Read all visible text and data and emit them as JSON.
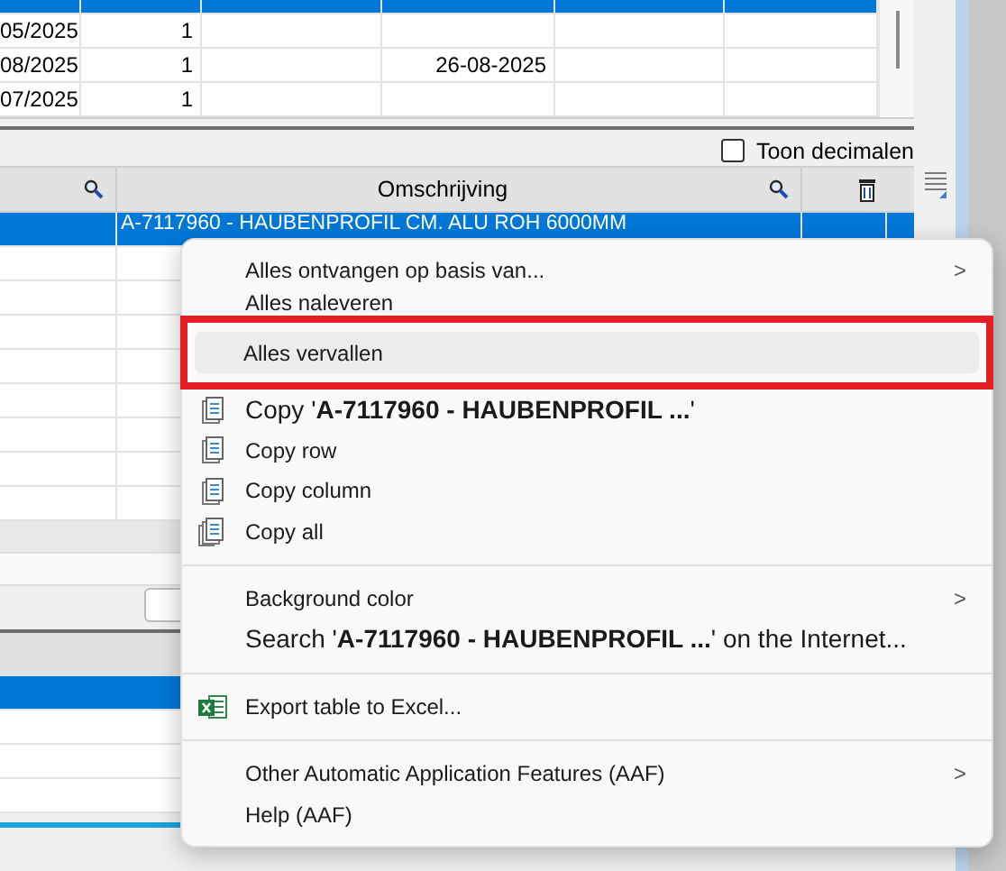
{
  "top_grid": {
    "rows": [
      {
        "selected": true
      },
      {
        "selected": false,
        "column_1": "05/2025",
        "column_2": "1"
      },
      {
        "selected": false,
        "column_1": "08/2025",
        "column_2": "1",
        "column_4": "26-08-2025"
      },
      {
        "selected": false,
        "column_1": "07/2025",
        "column_2": "1"
      }
    ]
  },
  "toolbar": {
    "checkbox": {
      "label": "Toon decimalen",
      "checked": false
    }
  },
  "lower_grid": {
    "heading": "Omschrijving",
    "rows": [
      {
        "selected": true,
        "description": "A-7117960 - HAUBENPROFIL CM. ALU ROH 6000MM"
      },
      {
        "selected": false
      },
      {
        "selected": false
      },
      {
        "selected": false
      },
      {
        "selected": false
      },
      {
        "selected": false
      },
      {
        "selected": false
      },
      {
        "selected": false
      },
      {
        "selected": false
      }
    ]
  },
  "bottom_grid": {
    "rows": [
      {
        "selected": true
      },
      {
        "selected": false
      },
      {
        "selected": false
      },
      {
        "selected": false
      }
    ]
  },
  "context_menu": {
    "items": [
      {
        "kind": "plain",
        "label": "Alles ontvangen op basis van...",
        "arrow": ">",
        "highlighted": false
      },
      {
        "kind": "plain",
        "label": "Alles naleveren",
        "highlighted": false
      },
      {
        "kind": "plain",
        "label": "Alles vervallen",
        "highlighted": true
      },
      {
        "kind": "copy-value",
        "label": "Copy '**A-7117960 - HAUBENPROFIL ...**'",
        "highlighted": false
      },
      {
        "kind": "copy",
        "label": "Copy row",
        "highlighted": false
      },
      {
        "kind": "copy",
        "label": "Copy column",
        "highlighted": false
      },
      {
        "kind": "copy-all",
        "label": "Copy all",
        "highlighted": false
      },
      {
        "kind": "separator"
      },
      {
        "kind": "plain",
        "label": "Background color",
        "arrow": ">",
        "highlighted": false
      },
      {
        "kind": "search",
        "label": "Search '**A-7117960 - HAUBENPROFIL ...**' on the Internet...",
        "highlighted": false
      },
      {
        "kind": "separator"
      },
      {
        "kind": "export",
        "label": "Export table to Excel...",
        "highlighted": false
      },
      {
        "kind": "separator"
      },
      {
        "kind": "plain",
        "label": "Other Automatic Application Features (AAF)",
        "arrow": ">",
        "highlighted": false
      },
      {
        "kind": "plain",
        "label": "Help (AAF)",
        "highlighted": false
      }
    ]
  }
}
